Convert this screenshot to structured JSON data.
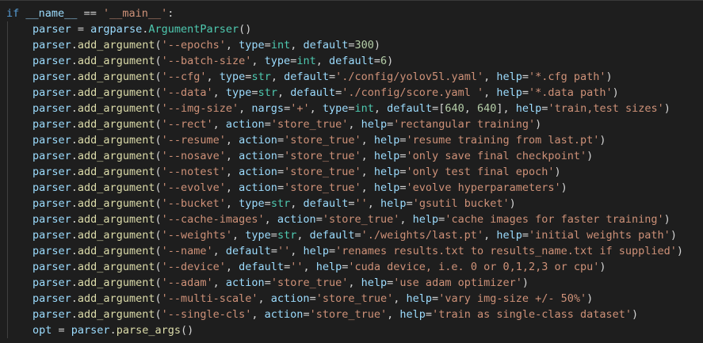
{
  "theme": {
    "background": "#1e1e1e",
    "colors": {
      "keyword": "#569cd6",
      "identifier": "#9cdcfe",
      "function": "#dcdcaa",
      "class": "#4ec9b0",
      "string": "#ce9178",
      "number": "#b5cea8",
      "plain": "#d4d4d4"
    }
  },
  "code_lines": [
    {
      "indent": 0,
      "tokens": [
        [
          "keyword",
          "if"
        ],
        [
          "op",
          " "
        ],
        [
          "ident",
          "__name__"
        ],
        [
          "op",
          " == "
        ],
        [
          "string",
          "'__main__'"
        ],
        [
          "op",
          ":"
        ]
      ]
    },
    {
      "indent": 1,
      "tokens": [
        [
          "ident",
          "parser"
        ],
        [
          "op",
          " = "
        ],
        [
          "ident",
          "argparse"
        ],
        [
          "op",
          "."
        ],
        [
          "class",
          "ArgumentParser"
        ],
        [
          "op",
          "()"
        ]
      ]
    },
    {
      "indent": 1,
      "tokens": [
        [
          "ident",
          "parser"
        ],
        [
          "op",
          "."
        ],
        [
          "func",
          "add_argument"
        ],
        [
          "op",
          "("
        ],
        [
          "string",
          "'--epochs'"
        ],
        [
          "op",
          ", "
        ],
        [
          "param",
          "type"
        ],
        [
          "op",
          "="
        ],
        [
          "class",
          "int"
        ],
        [
          "op",
          ", "
        ],
        [
          "param",
          "default"
        ],
        [
          "op",
          "="
        ],
        [
          "number",
          "300"
        ],
        [
          "op",
          ")"
        ]
      ]
    },
    {
      "indent": 1,
      "tokens": [
        [
          "ident",
          "parser"
        ],
        [
          "op",
          "."
        ],
        [
          "func",
          "add_argument"
        ],
        [
          "op",
          "("
        ],
        [
          "string",
          "'--batch-size'"
        ],
        [
          "op",
          ", "
        ],
        [
          "param",
          "type"
        ],
        [
          "op",
          "="
        ],
        [
          "class",
          "int"
        ],
        [
          "op",
          ", "
        ],
        [
          "param",
          "default"
        ],
        [
          "op",
          "="
        ],
        [
          "number",
          "6"
        ],
        [
          "op",
          ")"
        ]
      ]
    },
    {
      "indent": 1,
      "tokens": [
        [
          "ident",
          "parser"
        ],
        [
          "op",
          "."
        ],
        [
          "func",
          "add_argument"
        ],
        [
          "op",
          "("
        ],
        [
          "string",
          "'--cfg'"
        ],
        [
          "op",
          ", "
        ],
        [
          "param",
          "type"
        ],
        [
          "op",
          "="
        ],
        [
          "class",
          "str"
        ],
        [
          "op",
          ", "
        ],
        [
          "param",
          "default"
        ],
        [
          "op",
          "="
        ],
        [
          "string",
          "'./config/yolov5l.yaml'"
        ],
        [
          "op",
          ", "
        ],
        [
          "param",
          "help"
        ],
        [
          "op",
          "="
        ],
        [
          "string",
          "'*.cfg path'"
        ],
        [
          "op",
          ")"
        ]
      ]
    },
    {
      "indent": 1,
      "tokens": [
        [
          "ident",
          "parser"
        ],
        [
          "op",
          "."
        ],
        [
          "func",
          "add_argument"
        ],
        [
          "op",
          "("
        ],
        [
          "string",
          "'--data'"
        ],
        [
          "op",
          ", "
        ],
        [
          "param",
          "type"
        ],
        [
          "op",
          "="
        ],
        [
          "class",
          "str"
        ],
        [
          "op",
          ", "
        ],
        [
          "param",
          "default"
        ],
        [
          "op",
          "="
        ],
        [
          "string",
          "'./config/score.yaml '"
        ],
        [
          "op",
          ", "
        ],
        [
          "param",
          "help"
        ],
        [
          "op",
          "="
        ],
        [
          "string",
          "'*.data path'"
        ],
        [
          "op",
          ")"
        ]
      ]
    },
    {
      "indent": 1,
      "tokens": [
        [
          "ident",
          "parser"
        ],
        [
          "op",
          "."
        ],
        [
          "func",
          "add_argument"
        ],
        [
          "op",
          "("
        ],
        [
          "string",
          "'--img-size'"
        ],
        [
          "op",
          ", "
        ],
        [
          "param",
          "nargs"
        ],
        [
          "op",
          "="
        ],
        [
          "string",
          "'+'"
        ],
        [
          "op",
          ", "
        ],
        [
          "param",
          "type"
        ],
        [
          "op",
          "="
        ],
        [
          "class",
          "int"
        ],
        [
          "op",
          ", "
        ],
        [
          "param",
          "default"
        ],
        [
          "op",
          "=["
        ],
        [
          "number",
          "640"
        ],
        [
          "op",
          ", "
        ],
        [
          "number",
          "640"
        ],
        [
          "op",
          "], "
        ],
        [
          "param",
          "help"
        ],
        [
          "op",
          "="
        ],
        [
          "string",
          "'train,test sizes'"
        ],
        [
          "op",
          ")"
        ]
      ]
    },
    {
      "indent": 1,
      "tokens": [
        [
          "ident",
          "parser"
        ],
        [
          "op",
          "."
        ],
        [
          "func",
          "add_argument"
        ],
        [
          "op",
          "("
        ],
        [
          "string",
          "'--rect'"
        ],
        [
          "op",
          ", "
        ],
        [
          "param",
          "action"
        ],
        [
          "op",
          "="
        ],
        [
          "string",
          "'store_true'"
        ],
        [
          "op",
          ", "
        ],
        [
          "param",
          "help"
        ],
        [
          "op",
          "="
        ],
        [
          "string",
          "'rectangular training'"
        ],
        [
          "op",
          ")"
        ]
      ]
    },
    {
      "indent": 1,
      "tokens": [
        [
          "ident",
          "parser"
        ],
        [
          "op",
          "."
        ],
        [
          "func",
          "add_argument"
        ],
        [
          "op",
          "("
        ],
        [
          "string",
          "'--resume'"
        ],
        [
          "op",
          ", "
        ],
        [
          "param",
          "action"
        ],
        [
          "op",
          "="
        ],
        [
          "string",
          "'store_true'"
        ],
        [
          "op",
          ", "
        ],
        [
          "param",
          "help"
        ],
        [
          "op",
          "="
        ],
        [
          "string",
          "'resume training from last.pt'"
        ],
        [
          "op",
          ")"
        ]
      ]
    },
    {
      "indent": 1,
      "tokens": [
        [
          "ident",
          "parser"
        ],
        [
          "op",
          "."
        ],
        [
          "func",
          "add_argument"
        ],
        [
          "op",
          "("
        ],
        [
          "string",
          "'--nosave'"
        ],
        [
          "op",
          ", "
        ],
        [
          "param",
          "action"
        ],
        [
          "op",
          "="
        ],
        [
          "string",
          "'store_true'"
        ],
        [
          "op",
          ", "
        ],
        [
          "param",
          "help"
        ],
        [
          "op",
          "="
        ],
        [
          "string",
          "'only save final checkpoint'"
        ],
        [
          "op",
          ")"
        ]
      ]
    },
    {
      "indent": 1,
      "tokens": [
        [
          "ident",
          "parser"
        ],
        [
          "op",
          "."
        ],
        [
          "func",
          "add_argument"
        ],
        [
          "op",
          "("
        ],
        [
          "string",
          "'--notest'"
        ],
        [
          "op",
          ", "
        ],
        [
          "param",
          "action"
        ],
        [
          "op",
          "="
        ],
        [
          "string",
          "'store_true'"
        ],
        [
          "op",
          ", "
        ],
        [
          "param",
          "help"
        ],
        [
          "op",
          "="
        ],
        [
          "string",
          "'only test final epoch'"
        ],
        [
          "op",
          ")"
        ]
      ]
    },
    {
      "indent": 1,
      "tokens": [
        [
          "ident",
          "parser"
        ],
        [
          "op",
          "."
        ],
        [
          "func",
          "add_argument"
        ],
        [
          "op",
          "("
        ],
        [
          "string",
          "'--evolve'"
        ],
        [
          "op",
          ", "
        ],
        [
          "param",
          "action"
        ],
        [
          "op",
          "="
        ],
        [
          "string",
          "'store_true'"
        ],
        [
          "op",
          ", "
        ],
        [
          "param",
          "help"
        ],
        [
          "op",
          "="
        ],
        [
          "string",
          "'evolve hyperparameters'"
        ],
        [
          "op",
          ")"
        ]
      ]
    },
    {
      "indent": 1,
      "tokens": [
        [
          "ident",
          "parser"
        ],
        [
          "op",
          "."
        ],
        [
          "func",
          "add_argument"
        ],
        [
          "op",
          "("
        ],
        [
          "string",
          "'--bucket'"
        ],
        [
          "op",
          ", "
        ],
        [
          "param",
          "type"
        ],
        [
          "op",
          "="
        ],
        [
          "class",
          "str"
        ],
        [
          "op",
          ", "
        ],
        [
          "param",
          "default"
        ],
        [
          "op",
          "="
        ],
        [
          "string",
          "''"
        ],
        [
          "op",
          ", "
        ],
        [
          "param",
          "help"
        ],
        [
          "op",
          "="
        ],
        [
          "string",
          "'gsutil bucket'"
        ],
        [
          "op",
          ")"
        ]
      ]
    },
    {
      "indent": 1,
      "tokens": [
        [
          "ident",
          "parser"
        ],
        [
          "op",
          "."
        ],
        [
          "func",
          "add_argument"
        ],
        [
          "op",
          "("
        ],
        [
          "string",
          "'--cache-images'"
        ],
        [
          "op",
          ", "
        ],
        [
          "param",
          "action"
        ],
        [
          "op",
          "="
        ],
        [
          "string",
          "'store_true'"
        ],
        [
          "op",
          ", "
        ],
        [
          "param",
          "help"
        ],
        [
          "op",
          "="
        ],
        [
          "string",
          "'cache images for faster training'"
        ],
        [
          "op",
          ")"
        ]
      ]
    },
    {
      "indent": 1,
      "tokens": [
        [
          "ident",
          "parser"
        ],
        [
          "op",
          "."
        ],
        [
          "func",
          "add_argument"
        ],
        [
          "op",
          "("
        ],
        [
          "string",
          "'--weights'"
        ],
        [
          "op",
          ", "
        ],
        [
          "param",
          "type"
        ],
        [
          "op",
          "="
        ],
        [
          "class",
          "str"
        ],
        [
          "op",
          ", "
        ],
        [
          "param",
          "default"
        ],
        [
          "op",
          "="
        ],
        [
          "string",
          "'./weights/last.pt'"
        ],
        [
          "op",
          ", "
        ],
        [
          "param",
          "help"
        ],
        [
          "op",
          "="
        ],
        [
          "string",
          "'initial weights path'"
        ],
        [
          "op",
          ")"
        ]
      ]
    },
    {
      "indent": 1,
      "tokens": [
        [
          "ident",
          "parser"
        ],
        [
          "op",
          "."
        ],
        [
          "func",
          "add_argument"
        ],
        [
          "op",
          "("
        ],
        [
          "string",
          "'--name'"
        ],
        [
          "op",
          ", "
        ],
        [
          "param",
          "default"
        ],
        [
          "op",
          "="
        ],
        [
          "string",
          "''"
        ],
        [
          "op",
          ", "
        ],
        [
          "param",
          "help"
        ],
        [
          "op",
          "="
        ],
        [
          "string",
          "'renames results.txt to results_name.txt if supplied'"
        ],
        [
          "op",
          ")"
        ]
      ]
    },
    {
      "indent": 1,
      "tokens": [
        [
          "ident",
          "parser"
        ],
        [
          "op",
          "."
        ],
        [
          "func",
          "add_argument"
        ],
        [
          "op",
          "("
        ],
        [
          "string",
          "'--device'"
        ],
        [
          "op",
          ", "
        ],
        [
          "param",
          "default"
        ],
        [
          "op",
          "="
        ],
        [
          "string",
          "''"
        ],
        [
          "op",
          ", "
        ],
        [
          "param",
          "help"
        ],
        [
          "op",
          "="
        ],
        [
          "string",
          "'cuda device, i.e. 0 or 0,1,2,3 or cpu'"
        ],
        [
          "op",
          ")"
        ]
      ]
    },
    {
      "indent": 1,
      "tokens": [
        [
          "ident",
          "parser"
        ],
        [
          "op",
          "."
        ],
        [
          "func",
          "add_argument"
        ],
        [
          "op",
          "("
        ],
        [
          "string",
          "'--adam'"
        ],
        [
          "op",
          ", "
        ],
        [
          "param",
          "action"
        ],
        [
          "op",
          "="
        ],
        [
          "string",
          "'store_true'"
        ],
        [
          "op",
          ", "
        ],
        [
          "param",
          "help"
        ],
        [
          "op",
          "="
        ],
        [
          "string",
          "'use adam optimizer'"
        ],
        [
          "op",
          ")"
        ]
      ]
    },
    {
      "indent": 1,
      "tokens": [
        [
          "ident",
          "parser"
        ],
        [
          "op",
          "."
        ],
        [
          "func",
          "add_argument"
        ],
        [
          "op",
          "("
        ],
        [
          "string",
          "'--multi-scale'"
        ],
        [
          "op",
          ", "
        ],
        [
          "param",
          "action"
        ],
        [
          "op",
          "="
        ],
        [
          "string",
          "'store_true'"
        ],
        [
          "op",
          ", "
        ],
        [
          "param",
          "help"
        ],
        [
          "op",
          "="
        ],
        [
          "string",
          "'vary img-size +/- 50%'"
        ],
        [
          "op",
          ")"
        ]
      ]
    },
    {
      "indent": 1,
      "tokens": [
        [
          "ident",
          "parser"
        ],
        [
          "op",
          "."
        ],
        [
          "func",
          "add_argument"
        ],
        [
          "op",
          "("
        ],
        [
          "string",
          "'--single-cls'"
        ],
        [
          "op",
          ", "
        ],
        [
          "param",
          "action"
        ],
        [
          "op",
          "="
        ],
        [
          "string",
          "'store_true'"
        ],
        [
          "op",
          ", "
        ],
        [
          "param",
          "help"
        ],
        [
          "op",
          "="
        ],
        [
          "string",
          "'train as single-class dataset'"
        ],
        [
          "op",
          ")"
        ]
      ]
    },
    {
      "indent": 1,
      "tokens": [
        [
          "ident",
          "opt"
        ],
        [
          "op",
          " = "
        ],
        [
          "ident",
          "parser"
        ],
        [
          "op",
          "."
        ],
        [
          "func",
          "parse_args"
        ],
        [
          "op",
          "()"
        ]
      ]
    }
  ]
}
